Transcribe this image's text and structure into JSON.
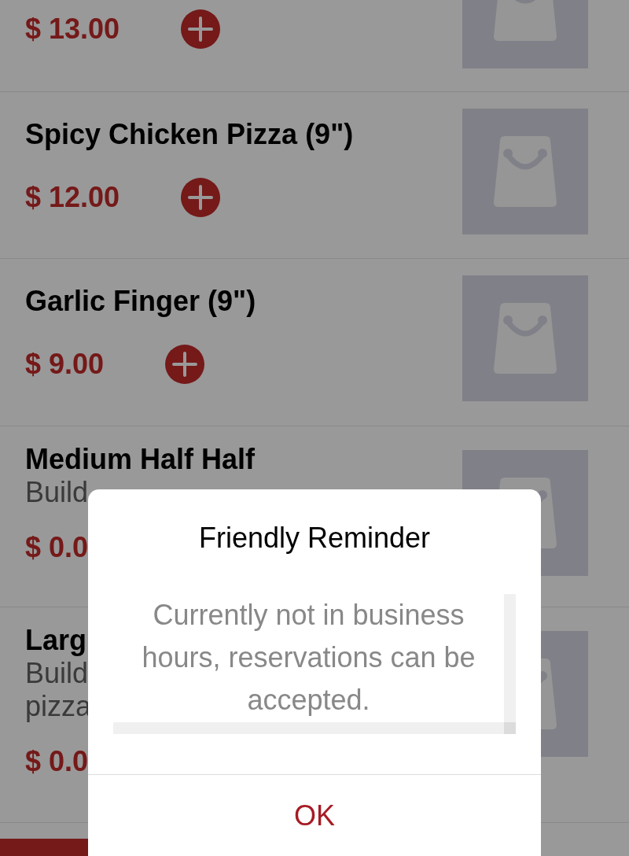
{
  "menu_items": [
    {
      "price": "$ 13.00",
      "add_button": true
    },
    {
      "title": "Spicy Chicken Pizza (9\")",
      "price": "$ 12.00",
      "add_button": true
    },
    {
      "title": "Garlic Finger (9\")",
      "price": "$ 9.00",
      "add_button": true
    },
    {
      "title": "Medium Half Half",
      "description": [
        "Build"
      ],
      "price": "$ 0.0"
    },
    {
      "title": "Larg",
      "description": [
        "Build",
        "pizza"
      ],
      "price": "$ 0.0"
    }
  ],
  "dialog": {
    "title": "Friendly Reminder",
    "message": "Currently not in business hours, reservations can be accepted.",
    "button": "OK"
  }
}
